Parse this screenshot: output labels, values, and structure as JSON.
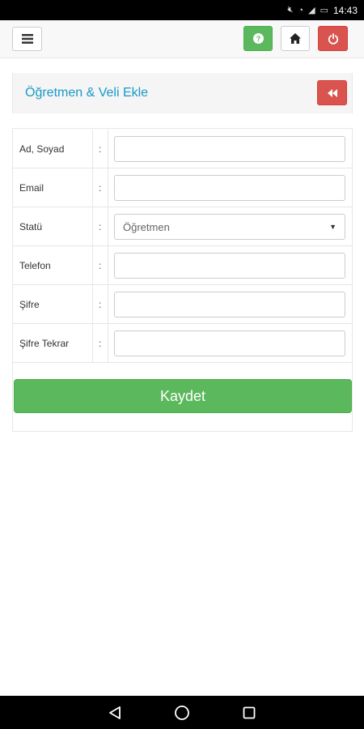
{
  "statusbar": {
    "time": "14:43",
    "icons": [
      "mute-icon",
      "alarm-icon",
      "wifi-icon",
      "signal-icon",
      "battery-icon"
    ]
  },
  "topbar": {
    "icons": [
      "menu-icon",
      "help-icon",
      "home-icon",
      "power-icon"
    ]
  },
  "heading": {
    "title": "Öğretmen & Veli Ekle",
    "back_icon": "fast-backward-icon"
  },
  "form": {
    "fields": [
      {
        "label": "Ad, Soyad",
        "value": ""
      },
      {
        "label": "Email",
        "value": ""
      },
      {
        "label": "Statü",
        "selected": "Öğretmen"
      },
      {
        "label": "Telefon",
        "value": ""
      },
      {
        "label": "Şifre",
        "value": ""
      },
      {
        "label": "Şifre Tekrar",
        "value": ""
      }
    ],
    "colon": ":",
    "save_label": "Kaydet"
  },
  "colors": {
    "accent_blue": "#1a98c8",
    "success": "#5cb85c",
    "danger": "#d9534f"
  },
  "navbar": {
    "icons": [
      "back-triangle-icon",
      "home-circle-icon",
      "recents-square-icon"
    ]
  }
}
